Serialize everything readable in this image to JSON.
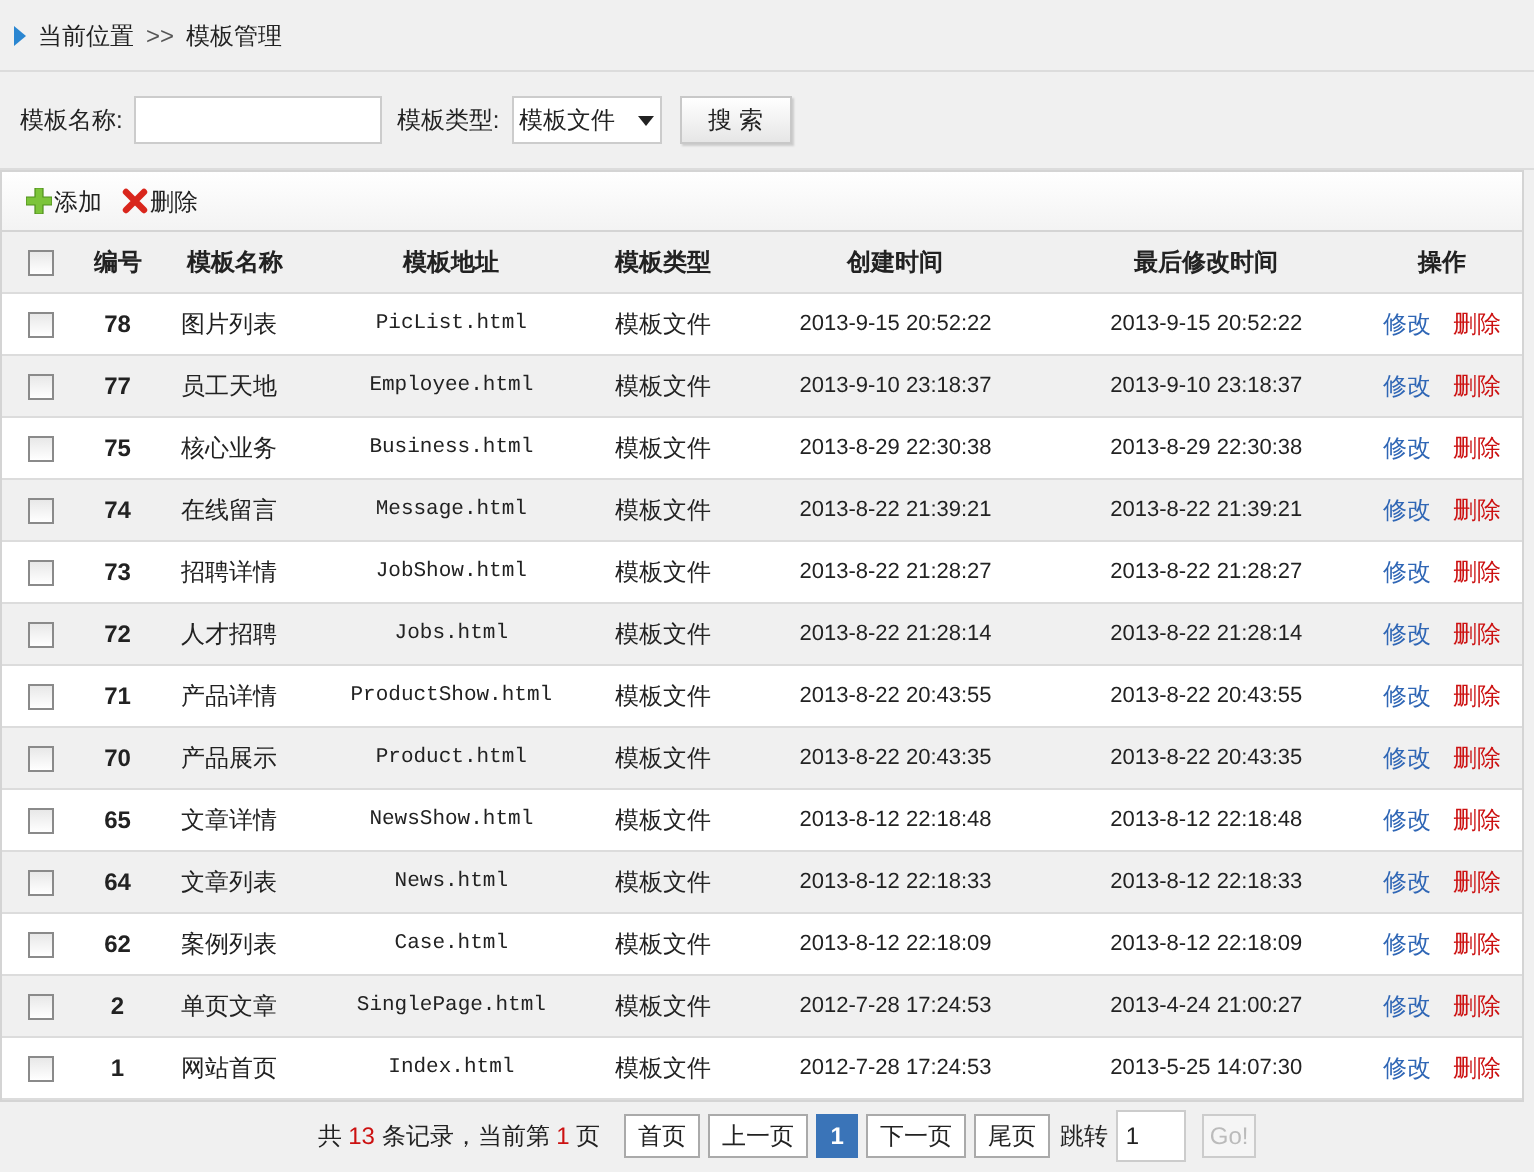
{
  "breadcrumb": {
    "current_label": "当前位置",
    "separator": ">>",
    "page": "模板管理"
  },
  "search": {
    "name_label": "模板名称:",
    "type_label": "模板类型:",
    "type_value": "模板文件",
    "button": "搜 索"
  },
  "toolbar": [
    {
      "kind": "add",
      "label": "添加"
    },
    {
      "kind": "delete",
      "label": "删除"
    }
  ],
  "table": {
    "select_all_checked": false,
    "columns": [
      "编号",
      "模板名称",
      "模板地址",
      "模板类型",
      "创建时间",
      "最后修改时间",
      "操作"
    ],
    "rows": [
      {
        "checked": false,
        "id": "78",
        "name": "图片列表",
        "file": "PicList.html",
        "type": "模板文件",
        "created": "2013-9-15 20:52:22",
        "modified": "2013-9-15 20:52:22",
        "edit": "修改",
        "delete": "删除"
      },
      {
        "checked": false,
        "id": "77",
        "name": "员工天地",
        "file": "Employee.html",
        "type": "模板文件",
        "created": "2013-9-10 23:18:37",
        "modified": "2013-9-10 23:18:37",
        "edit": "修改",
        "delete": "删除"
      },
      {
        "checked": false,
        "id": "75",
        "name": "核心业务",
        "file": "Business.html",
        "type": "模板文件",
        "created": "2013-8-29 22:30:38",
        "modified": "2013-8-29 22:30:38",
        "edit": "修改",
        "delete": "删除"
      },
      {
        "checked": false,
        "id": "74",
        "name": "在线留言",
        "file": "Message.html",
        "type": "模板文件",
        "created": "2013-8-22 21:39:21",
        "modified": "2013-8-22 21:39:21",
        "edit": "修改",
        "delete": "删除"
      },
      {
        "checked": false,
        "id": "73",
        "name": "招聘详情",
        "file": "JobShow.html",
        "type": "模板文件",
        "created": "2013-8-22 21:28:27",
        "modified": "2013-8-22 21:28:27",
        "edit": "修改",
        "delete": "删除"
      },
      {
        "checked": false,
        "id": "72",
        "name": "人才招聘",
        "file": "Jobs.html",
        "type": "模板文件",
        "created": "2013-8-22 21:28:14",
        "modified": "2013-8-22 21:28:14",
        "edit": "修改",
        "delete": "删除"
      },
      {
        "checked": false,
        "id": "71",
        "name": "产品详情",
        "file": "ProductShow.html",
        "type": "模板文件",
        "created": "2013-8-22 20:43:55",
        "modified": "2013-8-22 20:43:55",
        "edit": "修改",
        "delete": "删除"
      },
      {
        "checked": false,
        "id": "70",
        "name": "产品展示",
        "file": "Product.html",
        "type": "模板文件",
        "created": "2013-8-22 20:43:35",
        "modified": "2013-8-22 20:43:35",
        "edit": "修改",
        "delete": "删除"
      },
      {
        "checked": false,
        "id": "65",
        "name": "文章详情",
        "file": "NewsShow.html",
        "type": "模板文件",
        "created": "2013-8-12 22:18:48",
        "modified": "2013-8-12 22:18:48",
        "edit": "修改",
        "delete": "删除"
      },
      {
        "checked": false,
        "id": "64",
        "name": "文章列表",
        "file": "News.html",
        "type": "模板文件",
        "created": "2013-8-12 22:18:33",
        "modified": "2013-8-12 22:18:33",
        "edit": "修改",
        "delete": "删除"
      },
      {
        "checked": false,
        "id": "62",
        "name": "案例列表",
        "file": "Case.html",
        "type": "模板文件",
        "created": "2013-8-12 22:18:09",
        "modified": "2013-8-12 22:18:09",
        "edit": "修改",
        "delete": "删除"
      },
      {
        "checked": false,
        "id": "2",
        "name": "单页文章",
        "file": "SinglePage.html",
        "type": "模板文件",
        "created": "2012-7-28 17:24:53",
        "modified": "2013-4-24 21:00:27",
        "edit": "修改",
        "delete": "删除"
      },
      {
        "checked": false,
        "id": "1",
        "name": "网站首页",
        "file": "Index.html",
        "type": "模板文件",
        "created": "2012-7-28 17:24:53",
        "modified": "2013-5-25 14:07:30",
        "edit": "修改",
        "delete": "删除"
      }
    ]
  },
  "pagination": {
    "total_prefix": "共",
    "total": "13",
    "total_suffix": "条记录，当前第",
    "current": "1",
    "current_suffix": "页",
    "buttons": [
      {
        "label": "首页",
        "selected": false
      },
      {
        "label": "上一页",
        "selected": false
      },
      {
        "label": "1",
        "selected": true
      },
      {
        "label": "下一页",
        "selected": false
      },
      {
        "label": "尾页",
        "selected": false
      }
    ],
    "jump_label": "跳转",
    "jump_value": "1",
    "go": "Go!"
  }
}
